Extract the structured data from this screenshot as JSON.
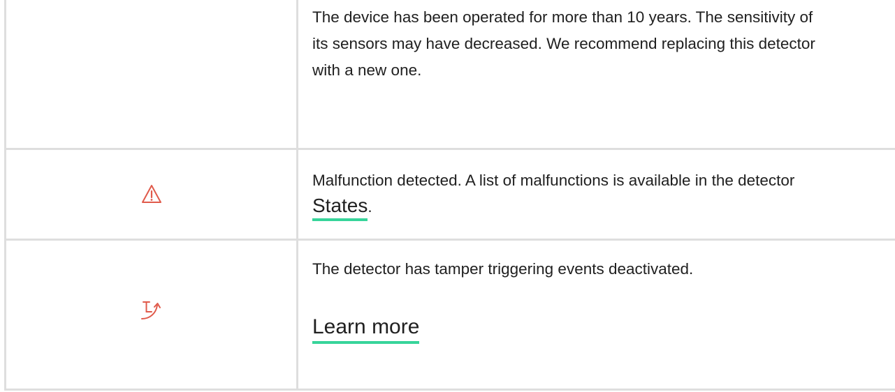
{
  "rows": [
    {
      "icon": "",
      "text": "The device has been operated for more than 10 years. The sensitivity of its sensors may have decreased. We recommend replacing this detector with a new one."
    },
    {
      "icon": "warning-triangle-icon",
      "text_before": "Malfunction detected. A list of malfunctions is available in the detector ",
      "link_label": "States",
      "text_after": "."
    },
    {
      "icon": "tamper-off-icon",
      "text": "The detector has tamper triggering events deactivated.",
      "link_label": "Learn more"
    }
  ],
  "colors": {
    "icon_red": "#e05a4b",
    "link_underline": "#37d49a",
    "border": "#dedede"
  }
}
